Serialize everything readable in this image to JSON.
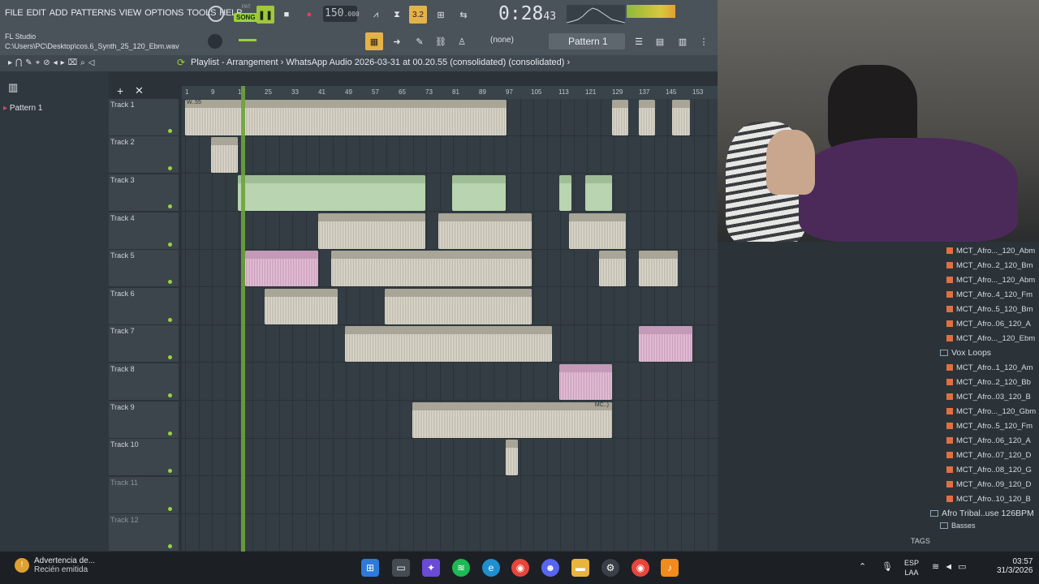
{
  "menus": [
    "FILE",
    "EDIT",
    "ADD",
    "PATTERNS",
    "VIEW",
    "OPTIONS",
    "TOOLS",
    "HELP"
  ],
  "transport": {
    "pat_label": "PAT",
    "song_label": "SONG",
    "bpm": "150",
    "bpm_decimal": ".000",
    "time_main": "0:28",
    "time_sub": "43",
    "step": "3.2"
  },
  "app": {
    "name": "FL Studio",
    "file_path": "C:\\Users\\PC\\Desktop\\cos.6_Synth_25_120_Ebm.wav"
  },
  "pattern_selector": {
    "label": "Pattern 1",
    "none_label": "(none)"
  },
  "playlist_title": "Playlist - Arrangement",
  "playlist_breadcrumb": "WhatsApp Audio 2026-03-31 at 00.20.55 (consolidated) (consolidated)",
  "pattern_list": [
    "Pattern 1"
  ],
  "ruler_ticks": [
    "1",
    "9",
    "17",
    "25",
    "33",
    "41",
    "49",
    "57",
    "65",
    "73",
    "81",
    "89",
    "97",
    "105",
    "113",
    "121",
    "129",
    "137",
    "145",
    "153"
  ],
  "tracks": [
    "Track 1",
    "Track 2",
    "Track 3",
    "Track 4",
    "Track 5",
    "Track 6",
    "Track 7",
    "Track 8",
    "Track 9",
    "Track 10",
    "Track 11",
    "Track 12"
  ],
  "clip_labels": {
    "w55": "W..55",
    "mc": "MC..)"
  },
  "browser": {
    "items_top": [
      "MCT_Afro..._120_Abm",
      "MCT_Afro..2_120_Bm",
      "MCT_Afro..._120_Abm",
      "MCT_Afro..4_120_Fm",
      "MCT_Afro..5_120_Bm",
      "MCT_Afro..06_120_A",
      "MCT_Afro..._120_Ebm"
    ],
    "folder_vox": "Vox Loops",
    "items_vox": [
      "MCT_Afro..1_120_Am",
      "MCT_Afro..2_120_Bb",
      "MCT_Afro..03_120_B",
      "MCT_Afro..._120_Gbm",
      "MCT_Afro..5_120_Fm",
      "MCT_Afro..06_120_A",
      "MCT_Afro..07_120_D",
      "MCT_Afro..08_120_G",
      "MCT_Afro..09_120_D",
      "MCT_Afro..10_120_B"
    ],
    "folder_afro": "Afro Tribal..use 126BPM",
    "folder_basses": "Basses",
    "tags_label": "TAGS"
  },
  "taskbar": {
    "notif_title": "Advertencia de...",
    "notif_sub": "Recién emitida",
    "lang_1": "ESP",
    "lang_2": "LAA",
    "time": "03:57",
    "date": "31/3/2026"
  }
}
